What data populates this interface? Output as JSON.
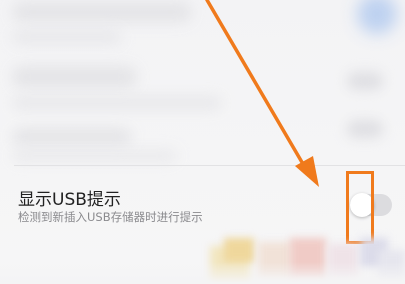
{
  "setting": {
    "title": "显示USB提示",
    "subtitle": "检测到新插入USB存储器时进行提示",
    "toggle_enabled": false
  },
  "colors": {
    "annotation": "#f07a1c",
    "toggle_track": "#dcdcdf",
    "toggle_knob": "#ffffff",
    "title_text": "#222222",
    "subtitle_text": "#8a8a8d"
  },
  "icons": {
    "annotation_arrow": "arrow-down-right-icon"
  }
}
